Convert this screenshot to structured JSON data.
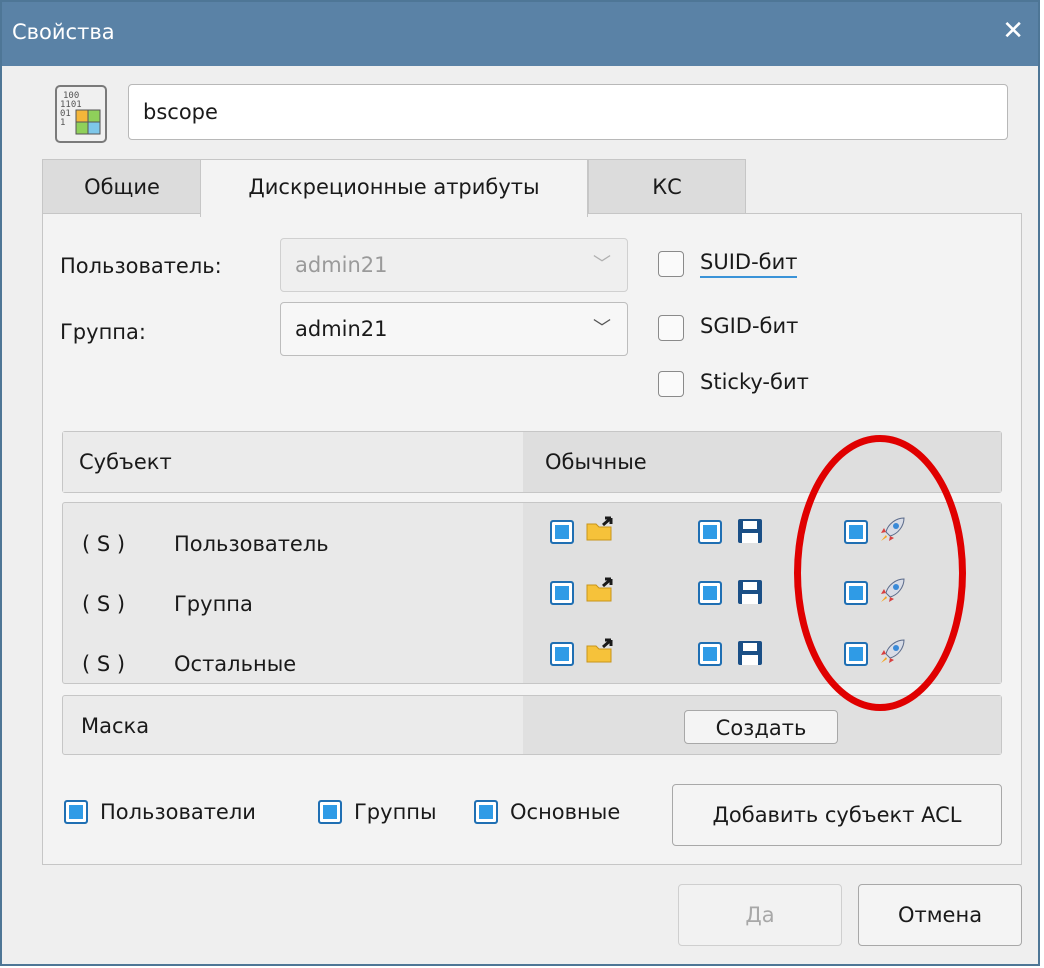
{
  "window": {
    "title": "Свойства",
    "close_glyph": "✕"
  },
  "file": {
    "name": "bscope",
    "icon": "binary-file-icon"
  },
  "tabs": [
    {
      "label": "Общие"
    },
    {
      "label": "Дискреционные атрибуты",
      "active": true
    },
    {
      "label": "КС"
    }
  ],
  "owner": {
    "user_label": "Пользователь:",
    "user_value": "admin21",
    "group_label": "Группа:",
    "group_value": "admin21"
  },
  "special_bits": {
    "suid": {
      "label": "SUID-бит",
      "checked": false
    },
    "sgid": {
      "label": "SGID-бит",
      "checked": false
    },
    "sticky": {
      "label": "Sticky-бит",
      "checked": false
    }
  },
  "acl_table": {
    "col_subject": "Субъект",
    "col_perms": "Обычные",
    "rows": [
      {
        "tag": "( S )",
        "name": "Пользователь",
        "read": true,
        "write": true,
        "exec": true
      },
      {
        "tag": "( S )",
        "name": "Группа",
        "read": true,
        "write": true,
        "exec": true
      },
      {
        "tag": "( S )",
        "name": "Остальные",
        "read": true,
        "write": true,
        "exec": true
      }
    ],
    "mask_label": "Маска",
    "mask_button": "Создать"
  },
  "filters": {
    "users": {
      "label": "Пользователи",
      "checked": true
    },
    "groups": {
      "label": "Группы",
      "checked": true
    },
    "basic": {
      "label": "Основные",
      "checked": true
    }
  },
  "add_acl_button": "Добавить субъект ACL",
  "footer": {
    "ok": "Да",
    "cancel": "Отмена"
  },
  "colors": {
    "titlebar": "#5a82a6",
    "checkbox_blue": "#2f9be6",
    "annotation": "#e00000"
  }
}
